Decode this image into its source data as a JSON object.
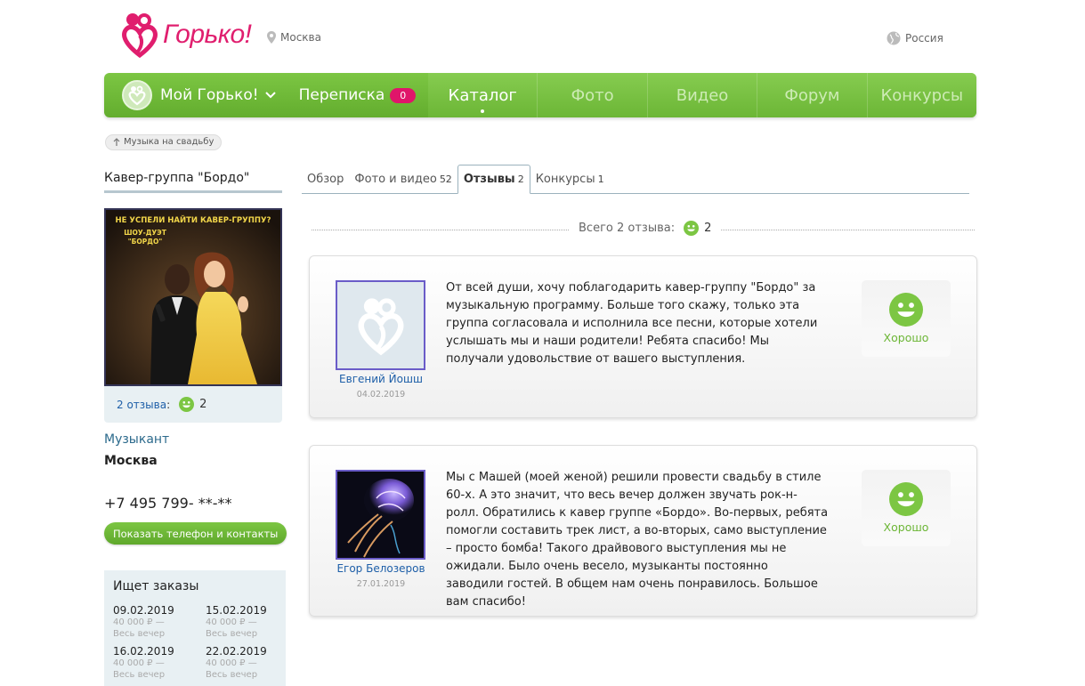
{
  "header": {
    "logo_text": "Горько!",
    "city": "Москва",
    "country": "Россия"
  },
  "nav": {
    "my_label": "Мой Горько!",
    "messages_label": "Переписка",
    "messages_count": "0",
    "tabs": [
      {
        "label": "Каталог",
        "active": true
      },
      {
        "label": "Фото",
        "active": false
      },
      {
        "label": "Видео",
        "active": false
      },
      {
        "label": "Форум",
        "active": false
      },
      {
        "label": "Конкурсы",
        "active": false
      }
    ]
  },
  "breadcrumb": {
    "label": "Музыка на свадьбу"
  },
  "vendor": {
    "name": "Кавер-группа \"Бордо\"",
    "poster_line1": "НЕ УСПЕЛИ НАЙТИ КАВЕР-ГРУППУ?",
    "poster_line2": "ШОУ-ДУЭТ",
    "poster_line3": "\"БОРДО\"",
    "reviews_link": "2 отзыва",
    "reviews_colon": ":",
    "reviews_good": "2",
    "role": "Музыкант",
    "city": "Москва",
    "phone": "+7 495 799- **-**",
    "show_contacts": "Показать телефон и контакты"
  },
  "orders": {
    "title": "Ищет заказы",
    "items": [
      {
        "date": "09.02.2019",
        "price": "40 000 ₽ —",
        "note": "Весь вечер"
      },
      {
        "date": "15.02.2019",
        "price": "40 000 ₽ —",
        "note": "Весь вечер"
      },
      {
        "date": "16.02.2019",
        "price": "40 000 ₽ —",
        "note": "Весь вечер"
      },
      {
        "date": "22.02.2019",
        "price": "40 000 ₽ —",
        "note": "Весь вечер"
      }
    ]
  },
  "tabs": [
    {
      "label": "Обзор",
      "count": ""
    },
    {
      "label": "Фото и видео",
      "count": "52"
    },
    {
      "label": "Отзывы",
      "count": "2",
      "active": true
    },
    {
      "label": "Конкурсы",
      "count": "1"
    }
  ],
  "summary": {
    "label": "Всего 2 отзыва:",
    "good_count": "2"
  },
  "reviews": [
    {
      "author": "Евгений Йошш",
      "date": "04.02.2019",
      "text": "От всей души, хочу поблагодарить кавер-группу \"Бордо\" за музыкальную программу. Больше того скажу, только эта группа согласовала и исполнила все песни, которые хотели услышать мы и наши родители! Ребята спасибо! Мы получали удовольствие от вашего выступления.",
      "verdict": "Хорошо",
      "avatar": "logo-placeholder"
    },
    {
      "author": "Егор Белозеров",
      "date": "27.01.2019",
      "text": "Мы с Машей (моей женой) решили провести свадьбу в стиле 60-х. А это значит, что весь вечер должен звучать рок-н-ролл. Обратились к кавер группе «Бордо». Во-первых, ребята помогли составить трек лист, а во-вторых, само выступление – просто бомба! Такого драйвового выступления мы не ожидали. Было очень весело, музыканты постоянно заводили гостей. В общем нам очень понравилось. Большое вам спасибо!",
      "verdict": "Хорошо",
      "avatar": "abstract-art"
    }
  ],
  "colors": {
    "brand_pink": "#e01e6e",
    "nav_green": "#6cb636",
    "link_blue": "#1e5fa8"
  }
}
